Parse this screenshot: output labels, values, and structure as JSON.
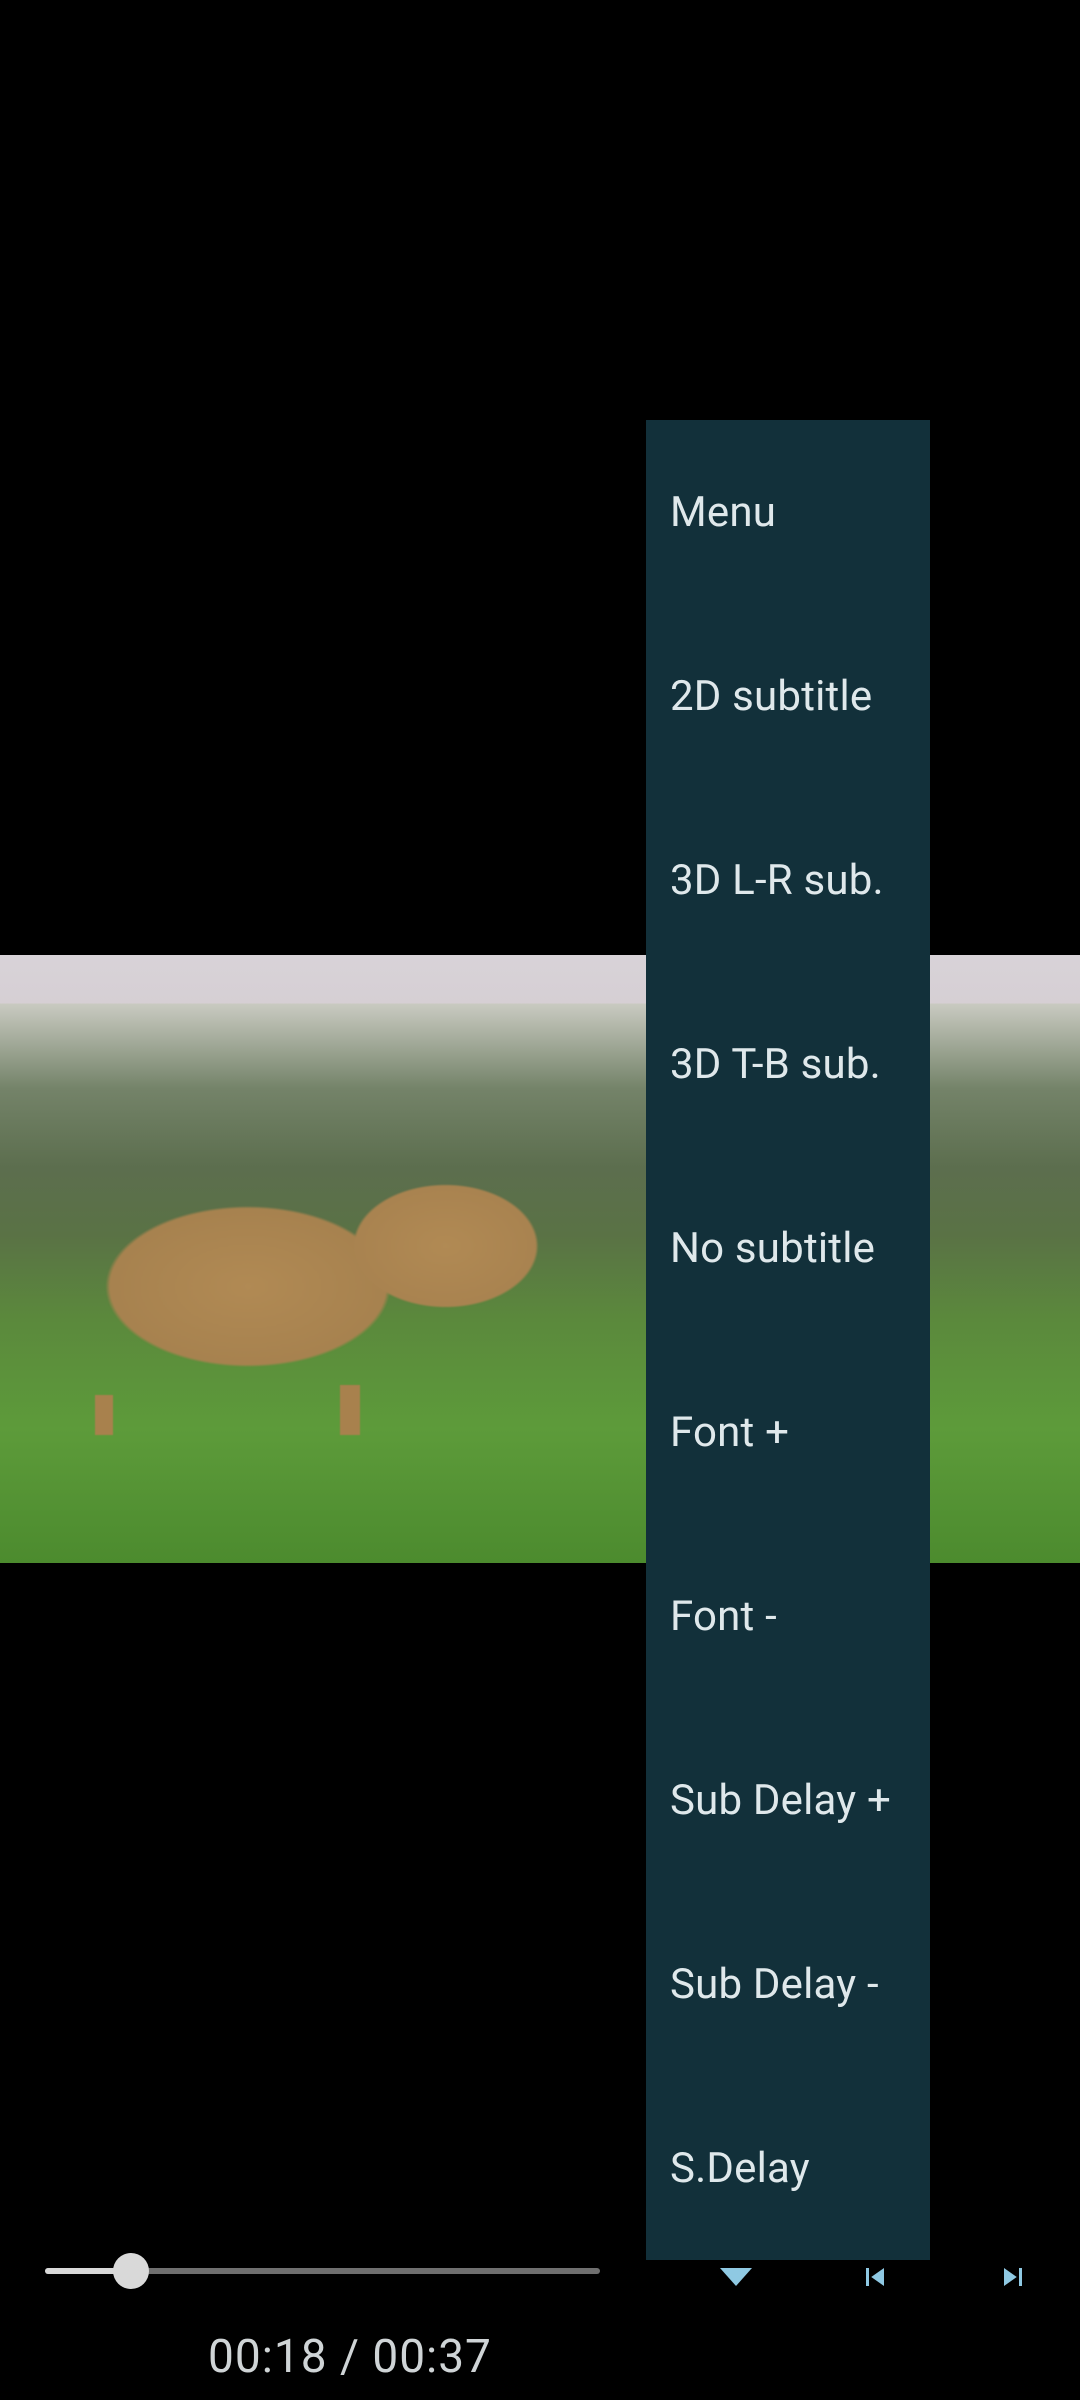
{
  "menu": {
    "items": [
      "Menu",
      "2D subtitle",
      "3D L-R sub.",
      "3D T-B sub.",
      "No subtitle",
      "Font +",
      "Font -",
      "Sub Delay +",
      "Sub Delay -",
      "S.Delay"
    ]
  },
  "playback": {
    "current_time": "00:18",
    "total_time": "00:37",
    "time_display": "00:18 / 00:37",
    "progress_percent": 15.5
  },
  "colors": {
    "menu_bg": "#12303a",
    "menu_text": "#dfe8eb",
    "accent": "#8fc9e3"
  }
}
